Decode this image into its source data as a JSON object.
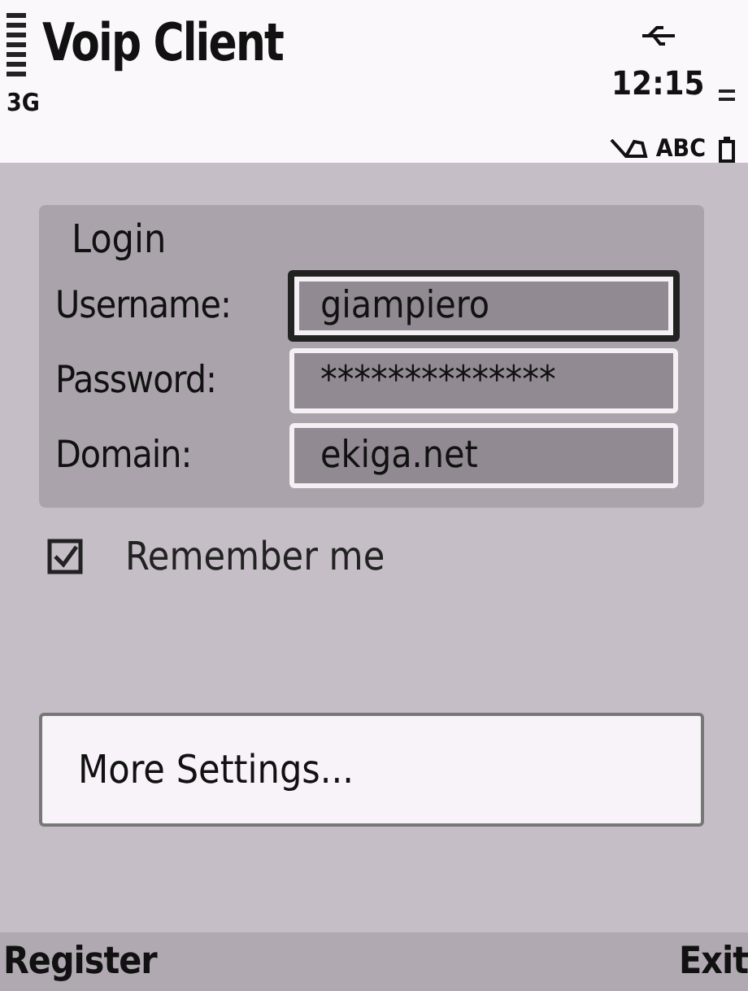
{
  "status_bar": {
    "title": "Voip Client",
    "network": "3G",
    "time": "12:15",
    "input_mode": "ABC"
  },
  "login": {
    "heading": "Login",
    "fields": [
      {
        "label": "Username:",
        "value": "giampiero",
        "focused": true
      },
      {
        "label": "Password:",
        "value": "**************",
        "focused": false
      },
      {
        "label": "Domain:",
        "value": "ekiga.net",
        "focused": false
      }
    ]
  },
  "remember": {
    "label": "Remember me",
    "checked": true
  },
  "more_button": {
    "label": "More Settings..."
  },
  "softkeys": {
    "left": "Register",
    "right": "Exit"
  }
}
